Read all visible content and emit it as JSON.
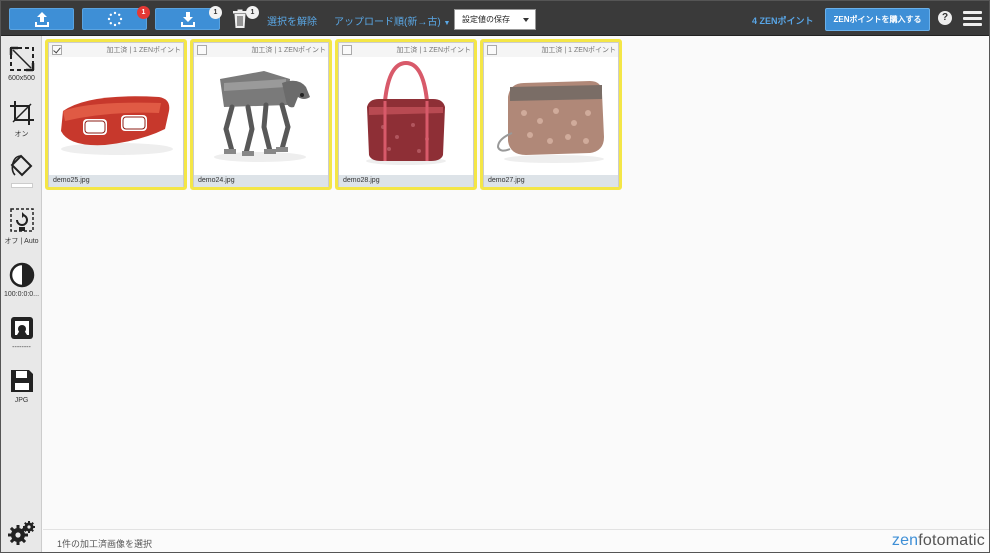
{
  "toolbar": {
    "upload_badge": "",
    "process_badge": "1",
    "download_badge": "1",
    "trash_badge": "1",
    "deselect_label": "選択を解除",
    "sort_label": "アップロード順(新→古)",
    "save_settings_label": "設定値の保存",
    "points_label": "4 ZENポイント",
    "buy_points_label": "ZENポイントを購入する",
    "help_label": "?"
  },
  "tools": [
    {
      "name": "resize",
      "label": "600x500"
    },
    {
      "name": "crop",
      "label": "オン"
    },
    {
      "name": "background",
      "label": ""
    },
    {
      "name": "rotate",
      "label": "オフ | Auto"
    },
    {
      "name": "contrast",
      "label": "100:0:0:0..."
    },
    {
      "name": "shadow",
      "label": "--------"
    },
    {
      "name": "format",
      "label": "JPG"
    }
  ],
  "thumbnails": [
    {
      "filename": "demo25.jpg",
      "status": "加工済",
      "cost": "1 ZENポイント",
      "checked": true,
      "subject": "red-glasses"
    },
    {
      "filename": "demo24.jpg",
      "status": "加工済",
      "cost": "1 ZENポイント",
      "checked": false,
      "subject": "walker-dog"
    },
    {
      "filename": "demo28.jpg",
      "status": "加工済",
      "cost": "1 ZENポイント",
      "checked": false,
      "subject": "red-handbag"
    },
    {
      "filename": "demo27.jpg",
      "status": "加工済",
      "cost": "1 ZENポイント",
      "checked": false,
      "subject": "sequin-pouch"
    }
  ],
  "status": {
    "selection_text": "1件の加工済画像を選択"
  },
  "brand": {
    "logo_zen": "zen",
    "logo_rest": "fotomatic"
  },
  "colors": {
    "accent": "#3e8fd6",
    "highlight": "#f4e646",
    "topbar": "#3a3a3a",
    "badge_red": "#e53935"
  }
}
